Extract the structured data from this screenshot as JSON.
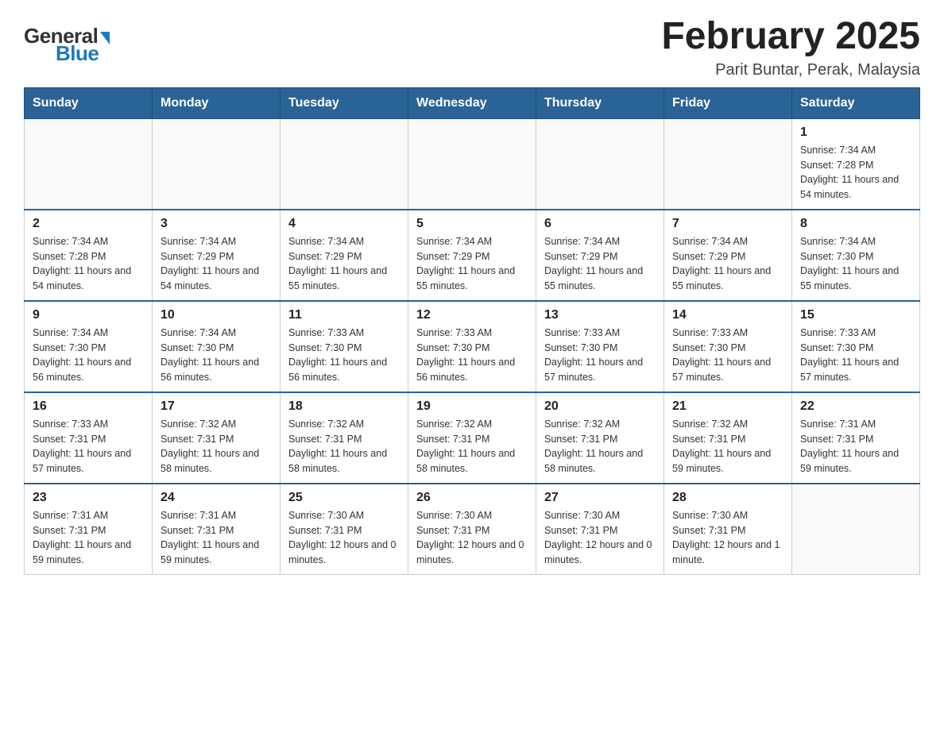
{
  "logo": {
    "general": "General",
    "blue": "Blue",
    "triangle": "▶"
  },
  "title": "February 2025",
  "location": "Parit Buntar, Perak, Malaysia",
  "weekdays": [
    "Sunday",
    "Monday",
    "Tuesday",
    "Wednesday",
    "Thursday",
    "Friday",
    "Saturday"
  ],
  "weeks": [
    [
      {
        "day": "",
        "info": ""
      },
      {
        "day": "",
        "info": ""
      },
      {
        "day": "",
        "info": ""
      },
      {
        "day": "",
        "info": ""
      },
      {
        "day": "",
        "info": ""
      },
      {
        "day": "",
        "info": ""
      },
      {
        "day": "1",
        "info": "Sunrise: 7:34 AM\nSunset: 7:28 PM\nDaylight: 11 hours and 54 minutes."
      }
    ],
    [
      {
        "day": "2",
        "info": "Sunrise: 7:34 AM\nSunset: 7:28 PM\nDaylight: 11 hours and 54 minutes."
      },
      {
        "day": "3",
        "info": "Sunrise: 7:34 AM\nSunset: 7:29 PM\nDaylight: 11 hours and 54 minutes."
      },
      {
        "day": "4",
        "info": "Sunrise: 7:34 AM\nSunset: 7:29 PM\nDaylight: 11 hours and 55 minutes."
      },
      {
        "day": "5",
        "info": "Sunrise: 7:34 AM\nSunset: 7:29 PM\nDaylight: 11 hours and 55 minutes."
      },
      {
        "day": "6",
        "info": "Sunrise: 7:34 AM\nSunset: 7:29 PM\nDaylight: 11 hours and 55 minutes."
      },
      {
        "day": "7",
        "info": "Sunrise: 7:34 AM\nSunset: 7:29 PM\nDaylight: 11 hours and 55 minutes."
      },
      {
        "day": "8",
        "info": "Sunrise: 7:34 AM\nSunset: 7:30 PM\nDaylight: 11 hours and 55 minutes."
      }
    ],
    [
      {
        "day": "9",
        "info": "Sunrise: 7:34 AM\nSunset: 7:30 PM\nDaylight: 11 hours and 56 minutes."
      },
      {
        "day": "10",
        "info": "Sunrise: 7:34 AM\nSunset: 7:30 PM\nDaylight: 11 hours and 56 minutes."
      },
      {
        "day": "11",
        "info": "Sunrise: 7:33 AM\nSunset: 7:30 PM\nDaylight: 11 hours and 56 minutes."
      },
      {
        "day": "12",
        "info": "Sunrise: 7:33 AM\nSunset: 7:30 PM\nDaylight: 11 hours and 56 minutes."
      },
      {
        "day": "13",
        "info": "Sunrise: 7:33 AM\nSunset: 7:30 PM\nDaylight: 11 hours and 57 minutes."
      },
      {
        "day": "14",
        "info": "Sunrise: 7:33 AM\nSunset: 7:30 PM\nDaylight: 11 hours and 57 minutes."
      },
      {
        "day": "15",
        "info": "Sunrise: 7:33 AM\nSunset: 7:30 PM\nDaylight: 11 hours and 57 minutes."
      }
    ],
    [
      {
        "day": "16",
        "info": "Sunrise: 7:33 AM\nSunset: 7:31 PM\nDaylight: 11 hours and 57 minutes."
      },
      {
        "day": "17",
        "info": "Sunrise: 7:32 AM\nSunset: 7:31 PM\nDaylight: 11 hours and 58 minutes."
      },
      {
        "day": "18",
        "info": "Sunrise: 7:32 AM\nSunset: 7:31 PM\nDaylight: 11 hours and 58 minutes."
      },
      {
        "day": "19",
        "info": "Sunrise: 7:32 AM\nSunset: 7:31 PM\nDaylight: 11 hours and 58 minutes."
      },
      {
        "day": "20",
        "info": "Sunrise: 7:32 AM\nSunset: 7:31 PM\nDaylight: 11 hours and 58 minutes."
      },
      {
        "day": "21",
        "info": "Sunrise: 7:32 AM\nSunset: 7:31 PM\nDaylight: 11 hours and 59 minutes."
      },
      {
        "day": "22",
        "info": "Sunrise: 7:31 AM\nSunset: 7:31 PM\nDaylight: 11 hours and 59 minutes."
      }
    ],
    [
      {
        "day": "23",
        "info": "Sunrise: 7:31 AM\nSunset: 7:31 PM\nDaylight: 11 hours and 59 minutes."
      },
      {
        "day": "24",
        "info": "Sunrise: 7:31 AM\nSunset: 7:31 PM\nDaylight: 11 hours and 59 minutes."
      },
      {
        "day": "25",
        "info": "Sunrise: 7:30 AM\nSunset: 7:31 PM\nDaylight: 12 hours and 0 minutes."
      },
      {
        "day": "26",
        "info": "Sunrise: 7:30 AM\nSunset: 7:31 PM\nDaylight: 12 hours and 0 minutes."
      },
      {
        "day": "27",
        "info": "Sunrise: 7:30 AM\nSunset: 7:31 PM\nDaylight: 12 hours and 0 minutes."
      },
      {
        "day": "28",
        "info": "Sunrise: 7:30 AM\nSunset: 7:31 PM\nDaylight: 12 hours and 1 minute."
      },
      {
        "day": "",
        "info": ""
      }
    ]
  ]
}
